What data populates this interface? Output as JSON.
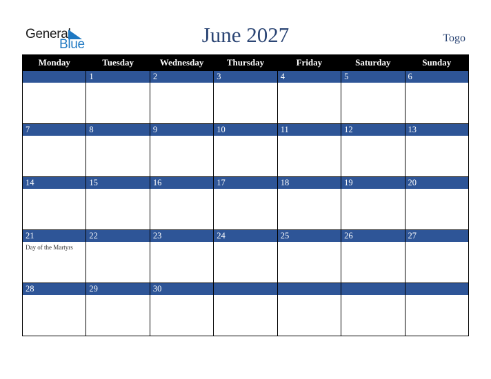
{
  "logo": {
    "line1": "General",
    "line2": "Blue"
  },
  "header": {
    "title": "June 2027",
    "country": "Togo"
  },
  "weekdays": [
    "Monday",
    "Tuesday",
    "Wednesday",
    "Thursday",
    "Friday",
    "Saturday",
    "Sunday"
  ],
  "weeks": [
    [
      {
        "day": ""
      },
      {
        "day": "1"
      },
      {
        "day": "2"
      },
      {
        "day": "3"
      },
      {
        "day": "4"
      },
      {
        "day": "5"
      },
      {
        "day": "6"
      }
    ],
    [
      {
        "day": "7"
      },
      {
        "day": "8"
      },
      {
        "day": "9"
      },
      {
        "day": "10"
      },
      {
        "day": "11"
      },
      {
        "day": "12"
      },
      {
        "day": "13"
      }
    ],
    [
      {
        "day": "14"
      },
      {
        "day": "15"
      },
      {
        "day": "16"
      },
      {
        "day": "17"
      },
      {
        "day": "18"
      },
      {
        "day": "19"
      },
      {
        "day": "20"
      }
    ],
    [
      {
        "day": "21",
        "event": "Day of the Martyrs"
      },
      {
        "day": "22"
      },
      {
        "day": "23"
      },
      {
        "day": "24"
      },
      {
        "day": "25"
      },
      {
        "day": "26"
      },
      {
        "day": "27"
      }
    ],
    [
      {
        "day": "28"
      },
      {
        "day": "29"
      },
      {
        "day": "30"
      },
      {
        "day": ""
      },
      {
        "day": ""
      },
      {
        "day": ""
      },
      {
        "day": ""
      }
    ]
  ],
  "colors": {
    "band": "#2e5597",
    "title": "#2b4574",
    "brand_blue": "#1e78c2"
  }
}
